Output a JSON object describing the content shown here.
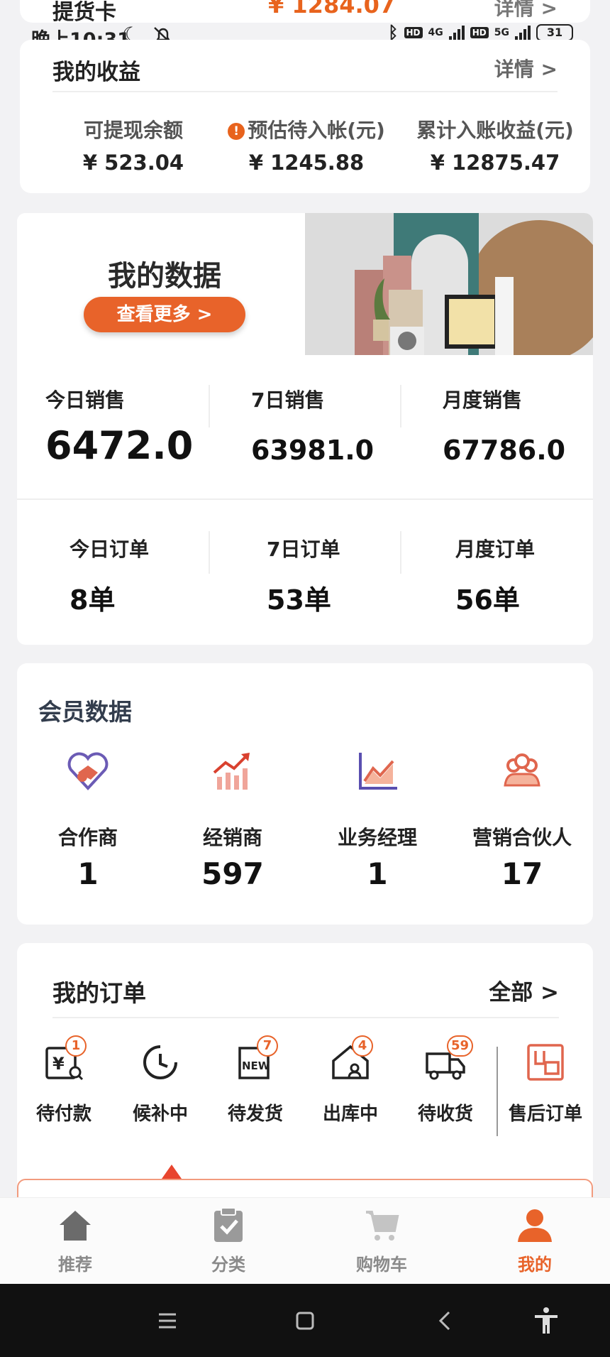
{
  "peek_card": {
    "left": "提货卡",
    "amount": "¥ 1284.07",
    "detail": "详情 >"
  },
  "status_bar": {
    "time": "晚上10:31",
    "net1": "4G",
    "net2": "5G",
    "hd": "HD",
    "battery": "31"
  },
  "earnings": {
    "title": "我的收益",
    "detail": "详情 >",
    "items": [
      {
        "label": "可提现余额",
        "value": "¥ 523.04"
      },
      {
        "label": "预估待入帐(元)",
        "value": "¥ 1245.88"
      },
      {
        "label": "累计入账收益(元)",
        "value": "¥ 12875.47"
      }
    ]
  },
  "my_data": {
    "banner_title": "我的数据",
    "banner_button": "查看更多 >",
    "sales": [
      {
        "label": "今日销售",
        "value": "6472.0"
      },
      {
        "label": "7日销售",
        "value": "63981.0"
      },
      {
        "label": "月度销售",
        "value": "67786.0"
      }
    ],
    "orders": [
      {
        "label": "今日订单",
        "value": "8单"
      },
      {
        "label": "7日订单",
        "value": "53单"
      },
      {
        "label": "月度订单",
        "value": "56单"
      }
    ]
  },
  "members": {
    "title": "会员数据",
    "items": [
      {
        "label": "合作商",
        "value": "1",
        "icon": "handshake-heart-icon"
      },
      {
        "label": "经销商",
        "value": "597",
        "icon": "growth-chart-icon"
      },
      {
        "label": "业务经理",
        "value": "1",
        "icon": "line-chart-icon"
      },
      {
        "label": "营销合伙人",
        "value": "17",
        "icon": "team-icon"
      }
    ]
  },
  "my_orders": {
    "title": "我的订单",
    "all": "全部 >",
    "items": [
      {
        "label": "待付款",
        "badge": "1",
        "icon": "pending-payment-icon"
      },
      {
        "label": "候补中",
        "badge": "",
        "icon": "clock-icon"
      },
      {
        "label": "待发货",
        "badge": "7",
        "icon": "new-box-icon"
      },
      {
        "label": "出库中",
        "badge": "4",
        "icon": "warehouse-icon"
      },
      {
        "label": "待收货",
        "badge": "59",
        "icon": "truck-icon"
      },
      {
        "label": "售后订单",
        "badge": "",
        "icon": "after-sales-icon"
      }
    ]
  },
  "bottom_nav": {
    "items": [
      {
        "label": "推荐",
        "icon": "home-icon"
      },
      {
        "label": "分类",
        "icon": "clipboard-icon"
      },
      {
        "label": "购物车",
        "icon": "cart-icon"
      },
      {
        "label": "我的",
        "icon": "user-icon"
      }
    ],
    "active_index": 3
  },
  "colors": {
    "accent": "#e8632a",
    "background": "#f2f2f4",
    "card": "#ffffff"
  }
}
